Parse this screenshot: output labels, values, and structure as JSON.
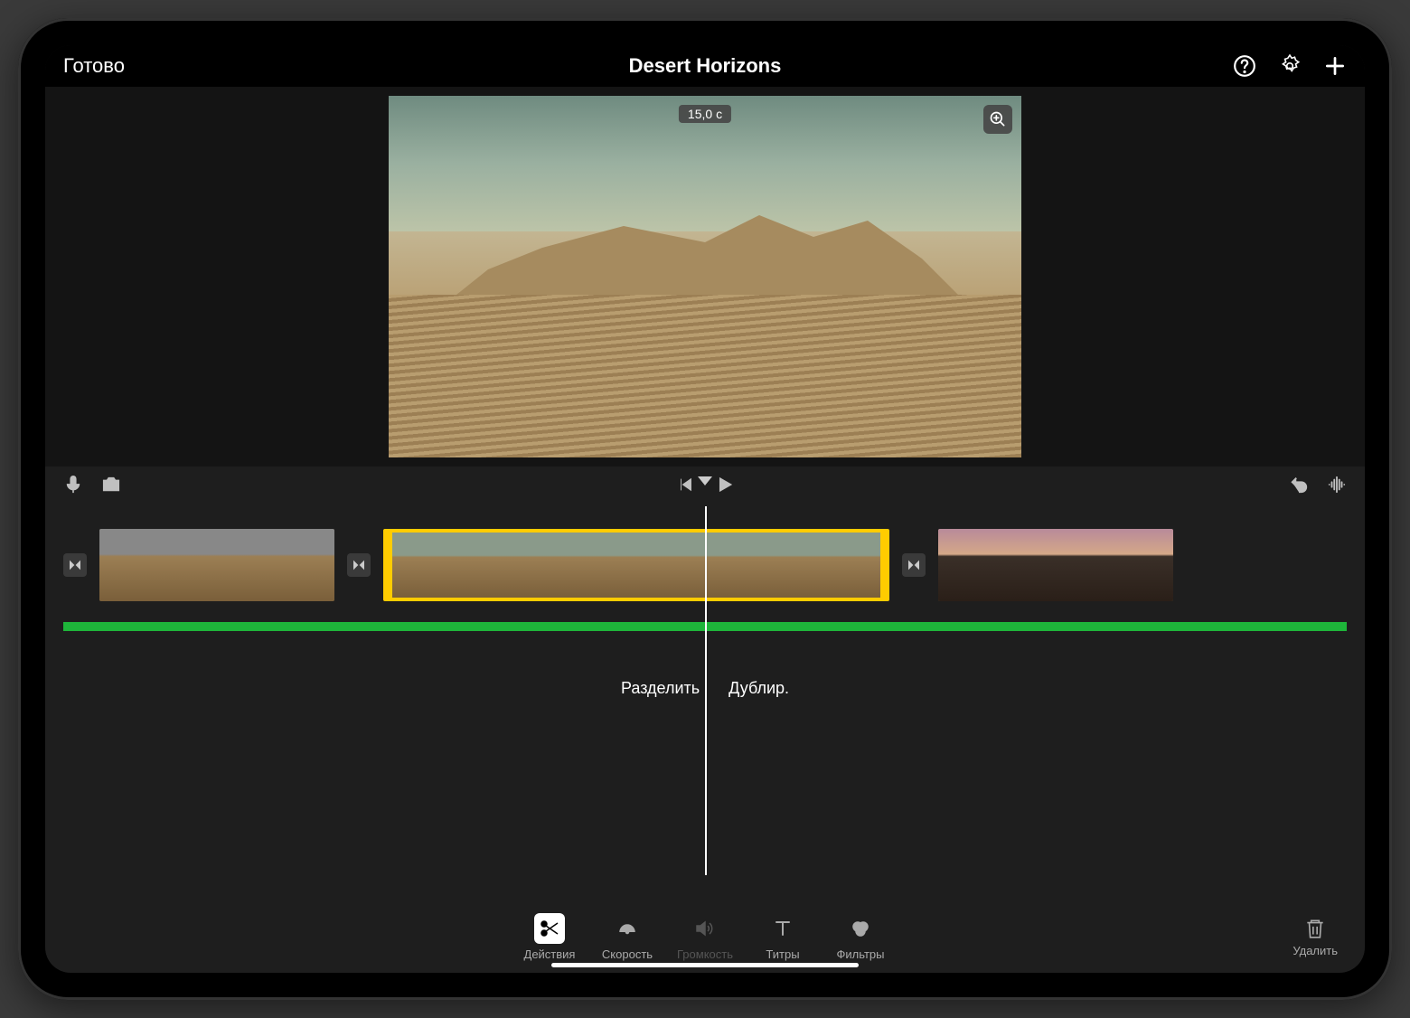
{
  "topbar": {
    "done_label": "Готово",
    "title": "Desert Horizons"
  },
  "preview": {
    "duration_label": "15,0 с"
  },
  "actions": {
    "split_label": "Разделить",
    "duplicate_label": "Дублир."
  },
  "tools": {
    "actions_label": "Действия",
    "speed_label": "Скорость",
    "volume_label": "Громкость",
    "titles_label": "Титры",
    "filters_label": "Фильтры",
    "delete_label": "Удалить"
  },
  "icons": {
    "help": "help-icon",
    "settings": "gear-icon",
    "add": "plus-icon",
    "zoom": "magnify-plus-icon",
    "mic": "microphone-icon",
    "camera": "camera-icon",
    "prev": "previous-icon",
    "play": "play-icon",
    "undo": "undo-icon",
    "waveform": "waveform-icon",
    "scissors": "scissors-icon",
    "gauge": "speedometer-icon",
    "speaker": "speaker-icon",
    "text": "text-icon",
    "circles": "filter-circles-icon",
    "trash": "trash-icon",
    "transition": "transition-icon"
  }
}
